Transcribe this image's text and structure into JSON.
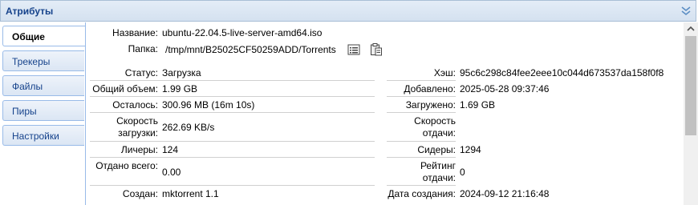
{
  "header": {
    "title": "Атрибуты"
  },
  "tabs": [
    {
      "label": "Общие"
    },
    {
      "label": "Трекеры"
    },
    {
      "label": "Файлы"
    },
    {
      "label": "Пиры"
    },
    {
      "label": "Настройки"
    }
  ],
  "general": {
    "name_label": "Название:",
    "name_value": "ubuntu-22.04.5-live-server-amd64.iso",
    "folder_label": "Папка:",
    "folder_value": "/tmp/mnt/B25025CF50259ADD/Torrents",
    "status_label": "Статус:",
    "status_value": "Загрузка",
    "hash_label": "Хэш:",
    "hash_value": "95c6c298c84fee2eee10c044d673537da158f0f8",
    "total_label": "Общий объем:",
    "total_value": "1.99 GB",
    "added_label": "Добавлено:",
    "added_value": "2025-05-28 09:37:46",
    "remaining_label": "Осталось:",
    "remaining_value": "300.96 MB (16m 10s)",
    "downloaded_label": "Загружено:",
    "downloaded_value": "1.69 GB",
    "dl_speed_label_1": "Скорость",
    "dl_speed_label_2": "загрузки:",
    "dl_speed_value": "262.69 KB/s",
    "ul_speed_label_1": "Скорость",
    "ul_speed_label_2": "отдачи:",
    "ul_speed_value": "",
    "leechers_label": "Личеры:",
    "leechers_value": "124",
    "seeders_label": "Сидеры:",
    "seeders_value": "1294",
    "uploaded_label": "Отдано всего:",
    "uploaded_value": "0.00",
    "ratio_label_1": "Рейтинг",
    "ratio_label_2": "отдачи:",
    "ratio_value": "0",
    "created_by_label": "Создан:",
    "created_by_value": "mktorrent 1.1",
    "created_date_label": "Дата создания:",
    "created_date_value": "2024-09-12 21:16:48"
  },
  "icons": {
    "folder_list": "list-icon",
    "paste": "clipboard-icon",
    "collapse": "double-chevron-down-icon"
  },
  "colors": {
    "header_text": "#15428b",
    "border": "#99bbe8"
  }
}
